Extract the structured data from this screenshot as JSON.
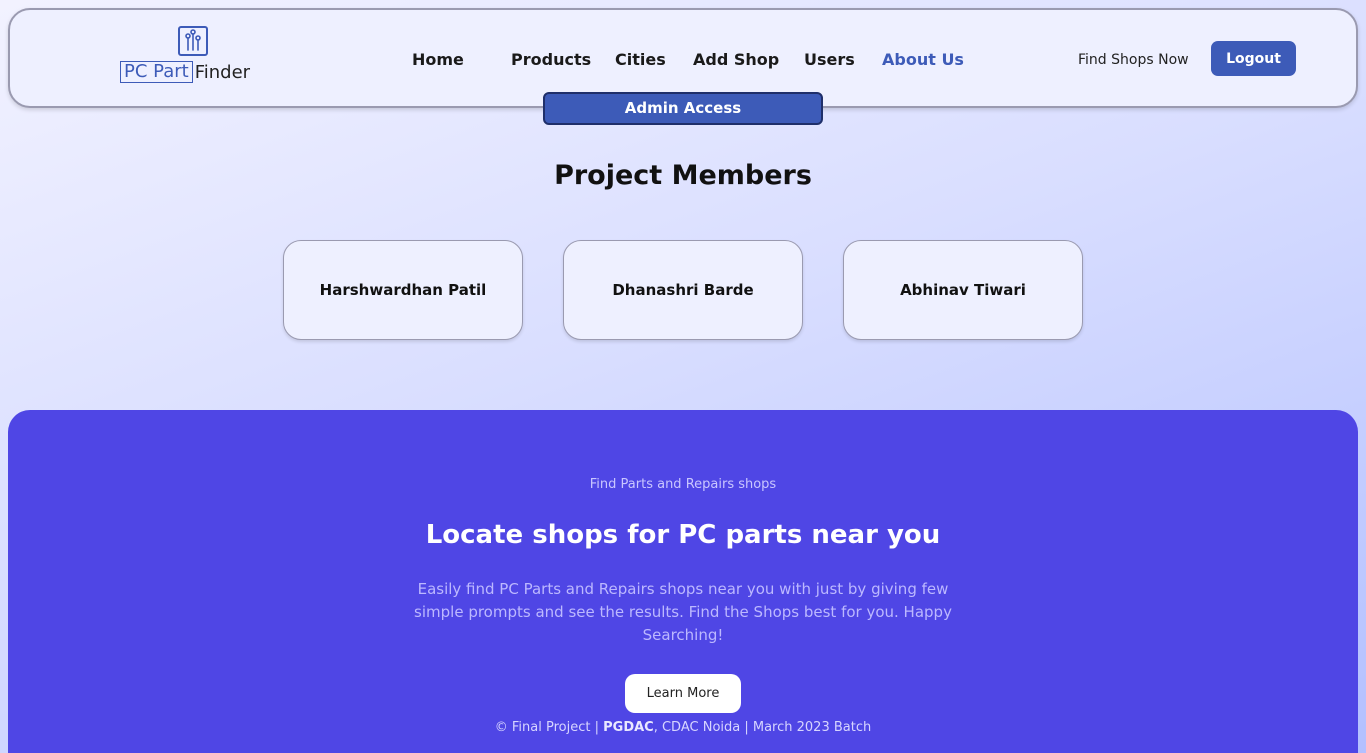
{
  "header": {
    "logo": {
      "box_text": "PC Part",
      "text": "Finder",
      "icon": "circuit-icon"
    },
    "nav": [
      {
        "label": "Home",
        "active": false
      },
      {
        "label": "Products",
        "active": false
      },
      {
        "label": "Cities",
        "active": false
      },
      {
        "label": "Add Shop",
        "active": false
      },
      {
        "label": "Users",
        "active": false
      },
      {
        "label": "About Us",
        "active": true
      }
    ],
    "find_shops": "Find Shops Now",
    "logout": "Logout",
    "admin_badge": "Admin Access"
  },
  "main": {
    "title": "Project Members",
    "members": [
      "Harshwardhan Patil",
      "Dhanashri Barde",
      "Abhinav Tiwari"
    ]
  },
  "footer": {
    "kicker": "Find Parts and Repairs shops",
    "heading": "Locate shops for PC parts near you",
    "description": "Easily find PC Parts and Repairs shops near you with just by giving few simple prompts and see the results. Find the Shops best for you. Happy Searching!",
    "learn_more": "Learn More",
    "copyright_prefix": "© Final Project | ",
    "copyright_bold": "PGDAC",
    "copyright_suffix": ", CDAC Noida | March 2023 Batch"
  },
  "colors": {
    "accent": "#3d5bb8",
    "footer_bg": "#4f46e5"
  }
}
